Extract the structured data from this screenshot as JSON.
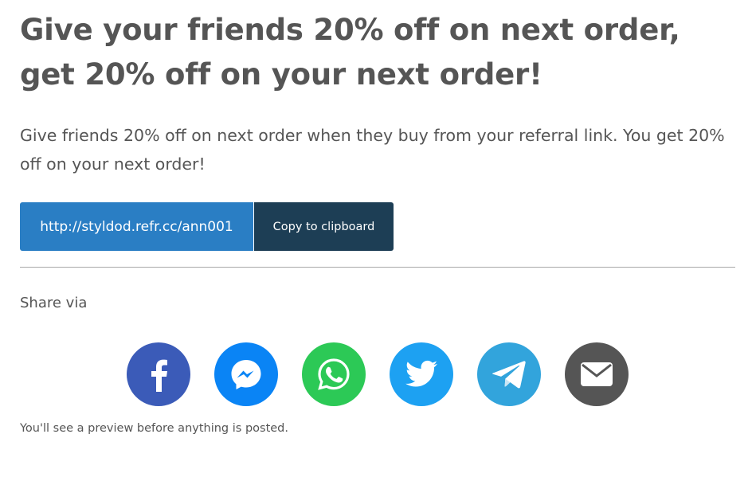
{
  "headline": "Give your friends 20% off on next order, get 20% off on your next order!",
  "description": "Give friends 20% off on next order when they buy from your referral link. You get 20% off on your next order!",
  "referral": {
    "link": "http://styldod.refr.cc/ann001",
    "copy_label": "Copy to clipboard"
  },
  "share": {
    "label": "Share via",
    "buttons": [
      {
        "network": "facebook",
        "icon": "facebook-icon",
        "color": "#3b5bb8"
      },
      {
        "network": "messenger",
        "icon": "messenger-icon",
        "color": "#0a84f5"
      },
      {
        "network": "whatsapp",
        "icon": "whatsapp-icon",
        "color": "#2cc956"
      },
      {
        "network": "twitter",
        "icon": "twitter-icon",
        "color": "#1da1f2"
      },
      {
        "network": "telegram",
        "icon": "telegram-icon",
        "color": "#32a4dc"
      },
      {
        "network": "email",
        "icon": "email-icon",
        "color": "#555555"
      }
    ],
    "preview_note": "You'll see a preview before anything is posted."
  },
  "colors": {
    "text": "#555555",
    "link_box": "#2a7ec4",
    "copy_button": "#1d3e55",
    "divider": "#a8a8a8"
  }
}
